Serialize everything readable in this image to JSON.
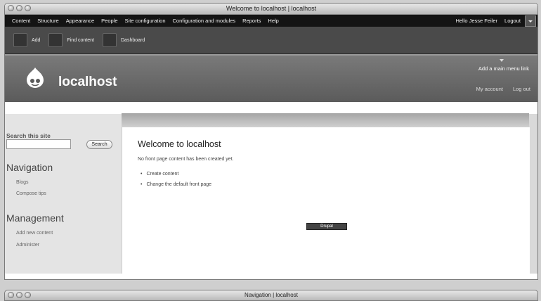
{
  "window": {
    "title": "Welcome to localhost | localhost"
  },
  "admin_menu": {
    "items": [
      "Content",
      "Structure",
      "Appearance",
      "People",
      "Site configuration",
      "Configuration and modules",
      "Reports",
      "Help"
    ],
    "greeting": "Hello Jesse Feiler",
    "logout": "Logout"
  },
  "shortcuts": {
    "items": [
      "Add",
      "Find content",
      "Dashboard"
    ]
  },
  "header": {
    "site_name": "localhost",
    "add_menu_link": "Add a main menu link",
    "my_account": "My account",
    "log_out": "Log out"
  },
  "sidebar": {
    "search_title": "Search this site",
    "search_placeholder": "",
    "search_button": "Search",
    "navigation_title": "Navigation",
    "navigation_items": [
      "Blogs",
      "Compose tips"
    ],
    "management_title": "Management",
    "management_items": [
      "Add new content",
      "Administer"
    ]
  },
  "main": {
    "title": "Welcome to localhost",
    "intro": "No front page content has been created yet.",
    "links": [
      "Create content",
      "Change the default front page"
    ],
    "powered_by": "Drupal"
  },
  "second_window": {
    "title": "Navigation | localhost"
  },
  "colors": {
    "admin_bar": "#141414",
    "header": "#6a6a6a",
    "sidebar": "#e4e4e4"
  }
}
